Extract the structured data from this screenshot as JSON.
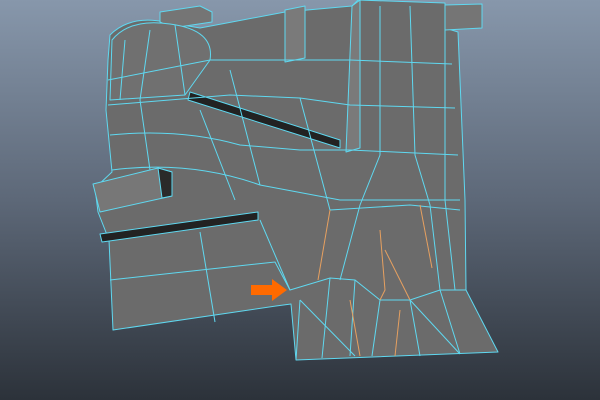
{
  "viewport": {
    "name": "3d-viewport",
    "colors": {
      "background_top": "#8797ab",
      "background_bottom": "#2c323a",
      "mesh_fill": "#6b6b6b",
      "mesh_dark": "#2a2a2a",
      "wire": "#5fd8f0",
      "selected_edges": "#e6a060",
      "arrow": "#ff6a00"
    },
    "objects": [
      {
        "name": "polygon-mesh",
        "selected_edges_present": true
      },
      {
        "name": "pointer-arrow"
      }
    ]
  }
}
